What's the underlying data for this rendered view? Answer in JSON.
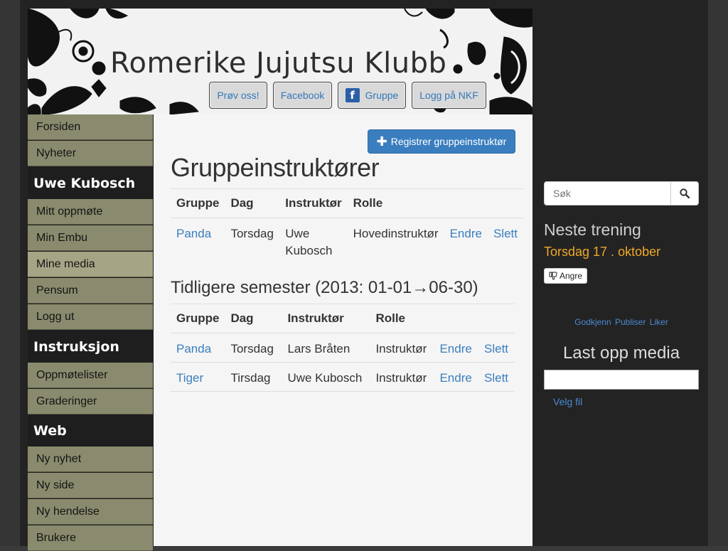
{
  "header": {
    "site_title": "Romerike Jujutsu Klubb",
    "buttons": [
      {
        "label": "Prøv oss!"
      },
      {
        "label": "Facebook"
      },
      {
        "label": "Gruppe",
        "icon": "facebook-icon"
      },
      {
        "label": "Logg på NKF"
      }
    ]
  },
  "sidebar": {
    "top_items": [
      "Forsiden",
      "Nyheter"
    ],
    "sections": [
      {
        "heading": "Uwe Kubosch",
        "items": [
          "Mitt oppmøte",
          "Min Embu",
          "Mine media",
          "Pensum",
          "Logg ut"
        ],
        "active": "Mine media"
      },
      {
        "heading": "Instruksjon",
        "items": [
          "Oppmøtelister",
          "Graderinger"
        ]
      },
      {
        "heading": "Web",
        "items": [
          "Ny nyhet",
          "Ny side",
          "Ny hendelse",
          "Brukere"
        ]
      }
    ]
  },
  "main": {
    "register_button": "Registrer gruppeinstruktør",
    "title": "Gruppeinstruktører",
    "current_table": {
      "headers": [
        "Gruppe",
        "Dag",
        "Instruktør",
        "Rolle"
      ],
      "rows": [
        {
          "gruppe": "Panda",
          "dag": "Torsdag",
          "instruktor": "Uwe Kubosch",
          "rolle": "Hovedinstruktør",
          "edit": "Endre",
          "delete": "Slett"
        }
      ]
    },
    "previous_title": "Tidligere semester (2013: 01-01→06-30)",
    "previous_table": {
      "headers": [
        "Gruppe",
        "Dag",
        "Instruktør",
        "Rolle"
      ],
      "rows": [
        {
          "gruppe": "Panda",
          "dag": "Torsdag",
          "instruktor": "Lars Bråten",
          "rolle": "Instruktør",
          "edit": "Endre",
          "delete": "Slett"
        },
        {
          "gruppe": "Tiger",
          "dag": "Tirsdag",
          "instruktor": "Uwe Kubosch",
          "rolle": "Instruktør",
          "edit": "Endre",
          "delete": "Slett"
        }
      ]
    }
  },
  "right": {
    "search_placeholder": "Søk",
    "next_training_title": "Neste trening",
    "next_training_date": "Torsdag 17 . oktober",
    "undo_label": "Angre",
    "approve_links": [
      "Godkjenn",
      "Publiser",
      "Liker"
    ],
    "upload_title": "Last opp media",
    "choose_file": "Velg fil"
  },
  "colors": {
    "accent": "#3a7ebf",
    "nav_item": "#8a8a6e",
    "nav_active": "#a5a586",
    "date_highlight": "#f0a928"
  }
}
